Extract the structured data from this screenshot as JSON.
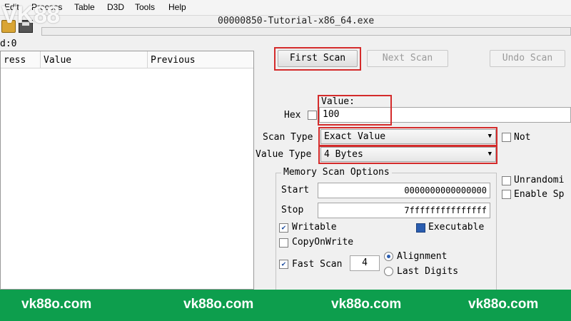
{
  "menu": [
    "Edit",
    "Process",
    "Table",
    "D3D",
    "Tools",
    "Help"
  ],
  "watermark": "VK88",
  "process_title": "00000850-Tutorial-x86_64.exe",
  "found_label": "d:0",
  "results_columns": [
    "ress",
    "Value",
    "Previous"
  ],
  "buttons": {
    "first_scan": "First Scan",
    "next_scan": "Next Scan",
    "undo_scan": "Undo Scan"
  },
  "value_section": {
    "value_label": "Value:",
    "hex_label": "Hex",
    "value": "100"
  },
  "scan_type": {
    "label": "Scan Type",
    "selected": "Exact Value"
  },
  "value_type": {
    "label": "Value Type",
    "selected": "4 Bytes"
  },
  "not_label": "Not",
  "right_options": [
    "Unrandomi",
    "Enable Sp"
  ],
  "memory_scan": {
    "title": "Memory Scan Options",
    "start_label": "Start",
    "start_value": "0000000000000000",
    "stop_label": "Stop",
    "stop_value": "7fffffffffffffff",
    "writable": "Writable",
    "executable": "Executable",
    "copy_on_write": "CopyOnWrite",
    "fast_scan": "Fast Scan",
    "fast_scan_value": "4",
    "alignment": "Alignment",
    "last_digits": "Last Digits"
  },
  "footer": [
    "vk88o.com",
    "vk88o.com",
    "vk88o.com",
    "vk88o.com"
  ],
  "colors": {
    "highlight": "#d42b2b",
    "footer_bg": "#0d9e4d"
  }
}
